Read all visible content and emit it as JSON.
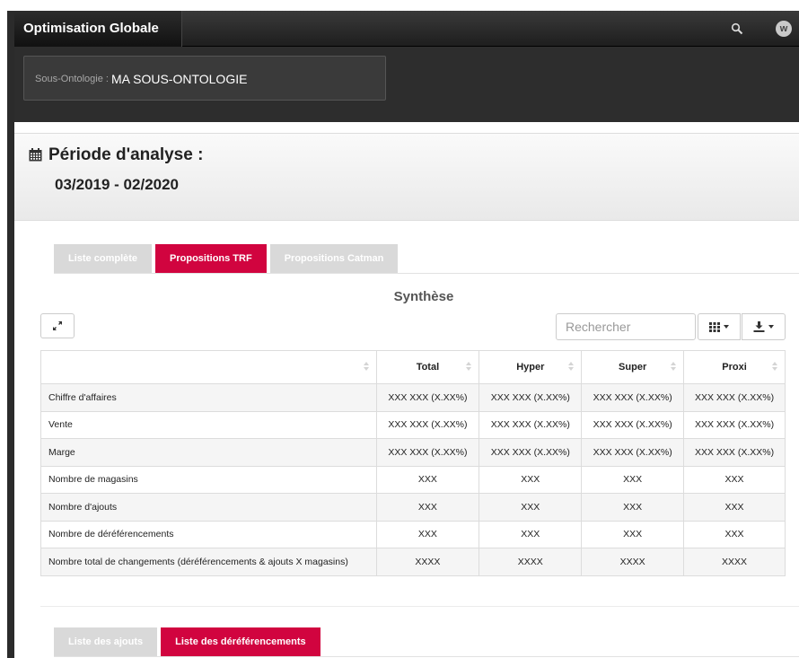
{
  "navbar": {
    "brand": "Optimisation Globale",
    "search_icon": "search-icon",
    "user_initial": "w"
  },
  "ontology": {
    "label": "Sous-Ontologie :",
    "value": "MA SOUS-ONTOLOGIE"
  },
  "period": {
    "icon": "calendar-icon",
    "title": "Période d'analyse :",
    "range": "03/2019 - 02/2020"
  },
  "tabs_top": [
    {
      "label": "Liste complète",
      "active": false
    },
    {
      "label": "Propositions TRF",
      "active": true
    },
    {
      "label": "Propositions Catman",
      "active": false
    }
  ],
  "synthese": {
    "title": "Synthèse",
    "search_placeholder": "Rechercher",
    "columns": [
      "",
      "Total",
      "Hyper",
      "Super",
      "Proxi"
    ],
    "rows": [
      {
        "label": "Chiffre d'affaires",
        "values": [
          "XXX XXX (X.XX%)",
          "XXX XXX (X.XX%)",
          "XXX XXX (X.XX%)",
          "XXX XXX (X.XX%)"
        ]
      },
      {
        "label": "Vente",
        "values": [
          "XXX XXX (X.XX%)",
          "XXX XXX (X.XX%)",
          "XXX XXX (X.XX%)",
          "XXX XXX (X.XX%)"
        ]
      },
      {
        "label": "Marge",
        "values": [
          "XXX XXX (X.XX%)",
          "XXX XXX (X.XX%)",
          "XXX XXX (X.XX%)",
          "XXX XXX (X.XX%)"
        ]
      },
      {
        "label": "Nombre de magasins",
        "values": [
          "XXX",
          "XXX",
          "XXX",
          "XXX"
        ]
      },
      {
        "label": "Nombre d'ajouts",
        "values": [
          "XXX",
          "XXX",
          "XXX",
          "XXX"
        ]
      },
      {
        "label": "Nombre de déréférencements",
        "values": [
          "XXX",
          "XXX",
          "XXX",
          "XXX"
        ]
      },
      {
        "label": "Nombre total de changements (déréférencements & ajouts X magasins)",
        "values": [
          "XXXX",
          "XXXX",
          "XXXX",
          "XXXX"
        ]
      }
    ]
  },
  "tabs_bottom": [
    {
      "label": "Liste des ajouts",
      "active": false
    },
    {
      "label": "Liste des déréférencements",
      "active": true
    }
  ],
  "colors": {
    "accent": "#d1043f",
    "navbar": "#1e1e1e",
    "inactive_tab": "#d9d9d9"
  }
}
